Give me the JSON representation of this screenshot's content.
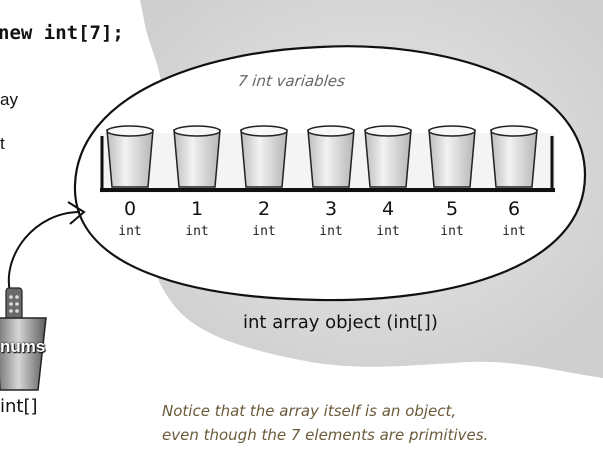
{
  "code_line": "new int[7];",
  "left_fragments": [
    "ay",
    "t"
  ],
  "caption_variables": "7 int variables",
  "elements": [
    {
      "index": "0",
      "type": "int"
    },
    {
      "index": "1",
      "type": "int"
    },
    {
      "index": "2",
      "type": "int"
    },
    {
      "index": "3",
      "type": "int"
    },
    {
      "index": "4",
      "type": "int"
    },
    {
      "index": "5",
      "type": "int"
    },
    {
      "index": "6",
      "type": "int"
    }
  ],
  "object_label": "int array object (int[])",
  "reference_variable": {
    "name": "nums",
    "type": "int[]"
  },
  "note_lines": [
    "Notice that the array itself is an object,",
    "even though the 7 elements are primitives."
  ],
  "colors": {
    "blob_fill": "#d8d8d8",
    "cup_fill": "#e6e6e6",
    "note_text": "#6b5a3a"
  }
}
